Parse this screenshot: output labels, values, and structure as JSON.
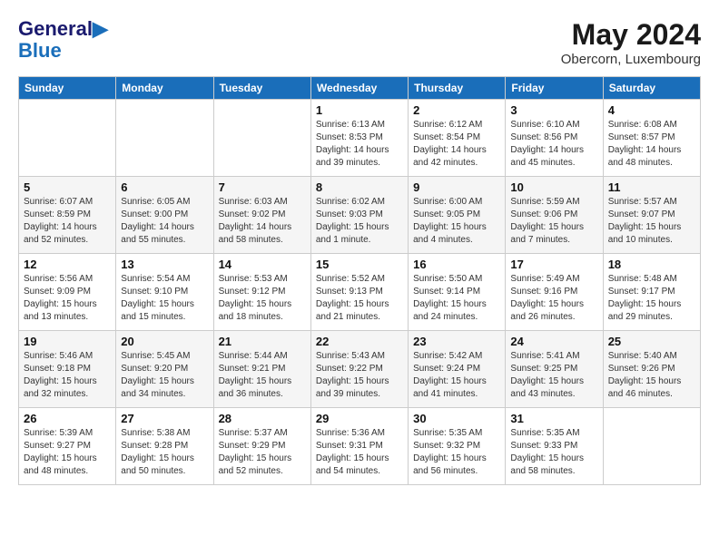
{
  "header": {
    "logo_line1": "General",
    "logo_line2": "Blue",
    "month": "May 2024",
    "location": "Obercorn, Luxembourg"
  },
  "weekdays": [
    "Sunday",
    "Monday",
    "Tuesday",
    "Wednesday",
    "Thursday",
    "Friday",
    "Saturday"
  ],
  "weeks": [
    [
      {
        "day": "",
        "info": ""
      },
      {
        "day": "",
        "info": ""
      },
      {
        "day": "",
        "info": ""
      },
      {
        "day": "1",
        "info": "Sunrise: 6:13 AM\nSunset: 8:53 PM\nDaylight: 14 hours\nand 39 minutes."
      },
      {
        "day": "2",
        "info": "Sunrise: 6:12 AM\nSunset: 8:54 PM\nDaylight: 14 hours\nand 42 minutes."
      },
      {
        "day": "3",
        "info": "Sunrise: 6:10 AM\nSunset: 8:56 PM\nDaylight: 14 hours\nand 45 minutes."
      },
      {
        "day": "4",
        "info": "Sunrise: 6:08 AM\nSunset: 8:57 PM\nDaylight: 14 hours\nand 48 minutes."
      }
    ],
    [
      {
        "day": "5",
        "info": "Sunrise: 6:07 AM\nSunset: 8:59 PM\nDaylight: 14 hours\nand 52 minutes."
      },
      {
        "day": "6",
        "info": "Sunrise: 6:05 AM\nSunset: 9:00 PM\nDaylight: 14 hours\nand 55 minutes."
      },
      {
        "day": "7",
        "info": "Sunrise: 6:03 AM\nSunset: 9:02 PM\nDaylight: 14 hours\nand 58 minutes."
      },
      {
        "day": "8",
        "info": "Sunrise: 6:02 AM\nSunset: 9:03 PM\nDaylight: 15 hours\nand 1 minute."
      },
      {
        "day": "9",
        "info": "Sunrise: 6:00 AM\nSunset: 9:05 PM\nDaylight: 15 hours\nand 4 minutes."
      },
      {
        "day": "10",
        "info": "Sunrise: 5:59 AM\nSunset: 9:06 PM\nDaylight: 15 hours\nand 7 minutes."
      },
      {
        "day": "11",
        "info": "Sunrise: 5:57 AM\nSunset: 9:07 PM\nDaylight: 15 hours\nand 10 minutes."
      }
    ],
    [
      {
        "day": "12",
        "info": "Sunrise: 5:56 AM\nSunset: 9:09 PM\nDaylight: 15 hours\nand 13 minutes."
      },
      {
        "day": "13",
        "info": "Sunrise: 5:54 AM\nSunset: 9:10 PM\nDaylight: 15 hours\nand 15 minutes."
      },
      {
        "day": "14",
        "info": "Sunrise: 5:53 AM\nSunset: 9:12 PM\nDaylight: 15 hours\nand 18 minutes."
      },
      {
        "day": "15",
        "info": "Sunrise: 5:52 AM\nSunset: 9:13 PM\nDaylight: 15 hours\nand 21 minutes."
      },
      {
        "day": "16",
        "info": "Sunrise: 5:50 AM\nSunset: 9:14 PM\nDaylight: 15 hours\nand 24 minutes."
      },
      {
        "day": "17",
        "info": "Sunrise: 5:49 AM\nSunset: 9:16 PM\nDaylight: 15 hours\nand 26 minutes."
      },
      {
        "day": "18",
        "info": "Sunrise: 5:48 AM\nSunset: 9:17 PM\nDaylight: 15 hours\nand 29 minutes."
      }
    ],
    [
      {
        "day": "19",
        "info": "Sunrise: 5:46 AM\nSunset: 9:18 PM\nDaylight: 15 hours\nand 32 minutes."
      },
      {
        "day": "20",
        "info": "Sunrise: 5:45 AM\nSunset: 9:20 PM\nDaylight: 15 hours\nand 34 minutes."
      },
      {
        "day": "21",
        "info": "Sunrise: 5:44 AM\nSunset: 9:21 PM\nDaylight: 15 hours\nand 36 minutes."
      },
      {
        "day": "22",
        "info": "Sunrise: 5:43 AM\nSunset: 9:22 PM\nDaylight: 15 hours\nand 39 minutes."
      },
      {
        "day": "23",
        "info": "Sunrise: 5:42 AM\nSunset: 9:24 PM\nDaylight: 15 hours\nand 41 minutes."
      },
      {
        "day": "24",
        "info": "Sunrise: 5:41 AM\nSunset: 9:25 PM\nDaylight: 15 hours\nand 43 minutes."
      },
      {
        "day": "25",
        "info": "Sunrise: 5:40 AM\nSunset: 9:26 PM\nDaylight: 15 hours\nand 46 minutes."
      }
    ],
    [
      {
        "day": "26",
        "info": "Sunrise: 5:39 AM\nSunset: 9:27 PM\nDaylight: 15 hours\nand 48 minutes."
      },
      {
        "day": "27",
        "info": "Sunrise: 5:38 AM\nSunset: 9:28 PM\nDaylight: 15 hours\nand 50 minutes."
      },
      {
        "day": "28",
        "info": "Sunrise: 5:37 AM\nSunset: 9:29 PM\nDaylight: 15 hours\nand 52 minutes."
      },
      {
        "day": "29",
        "info": "Sunrise: 5:36 AM\nSunset: 9:31 PM\nDaylight: 15 hours\nand 54 minutes."
      },
      {
        "day": "30",
        "info": "Sunrise: 5:35 AM\nSunset: 9:32 PM\nDaylight: 15 hours\nand 56 minutes."
      },
      {
        "day": "31",
        "info": "Sunrise: 5:35 AM\nSunset: 9:33 PM\nDaylight: 15 hours\nand 58 minutes."
      },
      {
        "day": "",
        "info": ""
      }
    ]
  ]
}
